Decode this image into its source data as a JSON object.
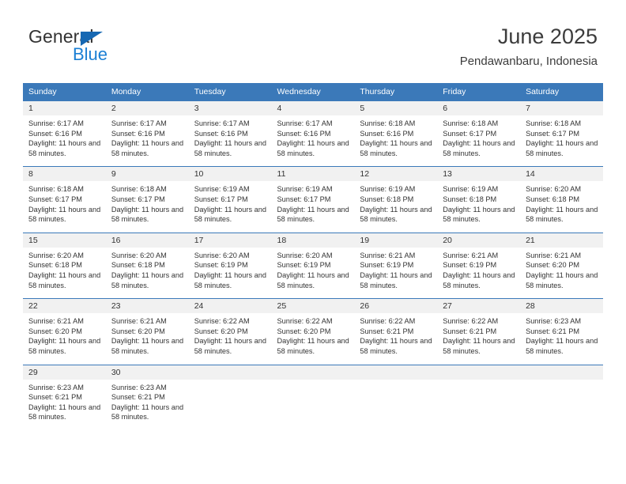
{
  "brand": {
    "name_part1": "General",
    "name_part2": "Blue",
    "accent_color": "#1b7fd4",
    "triangle_color": "#1668b3"
  },
  "header": {
    "title": "June 2025",
    "subtitle": "Pendawanbaru, Indonesia"
  },
  "calendar": {
    "header_bg": "#3b79b9",
    "daynum_bg": "#f1f1f1",
    "weekdays": [
      "Sunday",
      "Monday",
      "Tuesday",
      "Wednesday",
      "Thursday",
      "Friday",
      "Saturday"
    ],
    "weeks": [
      [
        {
          "day": "1",
          "sunrise": "Sunrise: 6:17 AM",
          "sunset": "Sunset: 6:16 PM",
          "daylight": "Daylight: 11 hours and 58 minutes."
        },
        {
          "day": "2",
          "sunrise": "Sunrise: 6:17 AM",
          "sunset": "Sunset: 6:16 PM",
          "daylight": "Daylight: 11 hours and 58 minutes."
        },
        {
          "day": "3",
          "sunrise": "Sunrise: 6:17 AM",
          "sunset": "Sunset: 6:16 PM",
          "daylight": "Daylight: 11 hours and 58 minutes."
        },
        {
          "day": "4",
          "sunrise": "Sunrise: 6:17 AM",
          "sunset": "Sunset: 6:16 PM",
          "daylight": "Daylight: 11 hours and 58 minutes."
        },
        {
          "day": "5",
          "sunrise": "Sunrise: 6:18 AM",
          "sunset": "Sunset: 6:16 PM",
          "daylight": "Daylight: 11 hours and 58 minutes."
        },
        {
          "day": "6",
          "sunrise": "Sunrise: 6:18 AM",
          "sunset": "Sunset: 6:17 PM",
          "daylight": "Daylight: 11 hours and 58 minutes."
        },
        {
          "day": "7",
          "sunrise": "Sunrise: 6:18 AM",
          "sunset": "Sunset: 6:17 PM",
          "daylight": "Daylight: 11 hours and 58 minutes."
        }
      ],
      [
        {
          "day": "8",
          "sunrise": "Sunrise: 6:18 AM",
          "sunset": "Sunset: 6:17 PM",
          "daylight": "Daylight: 11 hours and 58 minutes."
        },
        {
          "day": "9",
          "sunrise": "Sunrise: 6:18 AM",
          "sunset": "Sunset: 6:17 PM",
          "daylight": "Daylight: 11 hours and 58 minutes."
        },
        {
          "day": "10",
          "sunrise": "Sunrise: 6:19 AM",
          "sunset": "Sunset: 6:17 PM",
          "daylight": "Daylight: 11 hours and 58 minutes."
        },
        {
          "day": "11",
          "sunrise": "Sunrise: 6:19 AM",
          "sunset": "Sunset: 6:17 PM",
          "daylight": "Daylight: 11 hours and 58 minutes."
        },
        {
          "day": "12",
          "sunrise": "Sunrise: 6:19 AM",
          "sunset": "Sunset: 6:18 PM",
          "daylight": "Daylight: 11 hours and 58 minutes."
        },
        {
          "day": "13",
          "sunrise": "Sunrise: 6:19 AM",
          "sunset": "Sunset: 6:18 PM",
          "daylight": "Daylight: 11 hours and 58 minutes."
        },
        {
          "day": "14",
          "sunrise": "Sunrise: 6:20 AM",
          "sunset": "Sunset: 6:18 PM",
          "daylight": "Daylight: 11 hours and 58 minutes."
        }
      ],
      [
        {
          "day": "15",
          "sunrise": "Sunrise: 6:20 AM",
          "sunset": "Sunset: 6:18 PM",
          "daylight": "Daylight: 11 hours and 58 minutes."
        },
        {
          "day": "16",
          "sunrise": "Sunrise: 6:20 AM",
          "sunset": "Sunset: 6:18 PM",
          "daylight": "Daylight: 11 hours and 58 minutes."
        },
        {
          "day": "17",
          "sunrise": "Sunrise: 6:20 AM",
          "sunset": "Sunset: 6:19 PM",
          "daylight": "Daylight: 11 hours and 58 minutes."
        },
        {
          "day": "18",
          "sunrise": "Sunrise: 6:20 AM",
          "sunset": "Sunset: 6:19 PM",
          "daylight": "Daylight: 11 hours and 58 minutes."
        },
        {
          "day": "19",
          "sunrise": "Sunrise: 6:21 AM",
          "sunset": "Sunset: 6:19 PM",
          "daylight": "Daylight: 11 hours and 58 minutes."
        },
        {
          "day": "20",
          "sunrise": "Sunrise: 6:21 AM",
          "sunset": "Sunset: 6:19 PM",
          "daylight": "Daylight: 11 hours and 58 minutes."
        },
        {
          "day": "21",
          "sunrise": "Sunrise: 6:21 AM",
          "sunset": "Sunset: 6:20 PM",
          "daylight": "Daylight: 11 hours and 58 minutes."
        }
      ],
      [
        {
          "day": "22",
          "sunrise": "Sunrise: 6:21 AM",
          "sunset": "Sunset: 6:20 PM",
          "daylight": "Daylight: 11 hours and 58 minutes."
        },
        {
          "day": "23",
          "sunrise": "Sunrise: 6:21 AM",
          "sunset": "Sunset: 6:20 PM",
          "daylight": "Daylight: 11 hours and 58 minutes."
        },
        {
          "day": "24",
          "sunrise": "Sunrise: 6:22 AM",
          "sunset": "Sunset: 6:20 PM",
          "daylight": "Daylight: 11 hours and 58 minutes."
        },
        {
          "day": "25",
          "sunrise": "Sunrise: 6:22 AM",
          "sunset": "Sunset: 6:20 PM",
          "daylight": "Daylight: 11 hours and 58 minutes."
        },
        {
          "day": "26",
          "sunrise": "Sunrise: 6:22 AM",
          "sunset": "Sunset: 6:21 PM",
          "daylight": "Daylight: 11 hours and 58 minutes."
        },
        {
          "day": "27",
          "sunrise": "Sunrise: 6:22 AM",
          "sunset": "Sunset: 6:21 PM",
          "daylight": "Daylight: 11 hours and 58 minutes."
        },
        {
          "day": "28",
          "sunrise": "Sunrise: 6:23 AM",
          "sunset": "Sunset: 6:21 PM",
          "daylight": "Daylight: 11 hours and 58 minutes."
        }
      ],
      [
        {
          "day": "29",
          "sunrise": "Sunrise: 6:23 AM",
          "sunset": "Sunset: 6:21 PM",
          "daylight": "Daylight: 11 hours and 58 minutes."
        },
        {
          "day": "30",
          "sunrise": "Sunrise: 6:23 AM",
          "sunset": "Sunset: 6:21 PM",
          "daylight": "Daylight: 11 hours and 58 minutes."
        },
        {
          "day": "",
          "sunrise": "",
          "sunset": "",
          "daylight": ""
        },
        {
          "day": "",
          "sunrise": "",
          "sunset": "",
          "daylight": ""
        },
        {
          "day": "",
          "sunrise": "",
          "sunset": "",
          "daylight": ""
        },
        {
          "day": "",
          "sunrise": "",
          "sunset": "",
          "daylight": ""
        },
        {
          "day": "",
          "sunrise": "",
          "sunset": "",
          "daylight": ""
        }
      ]
    ]
  }
}
